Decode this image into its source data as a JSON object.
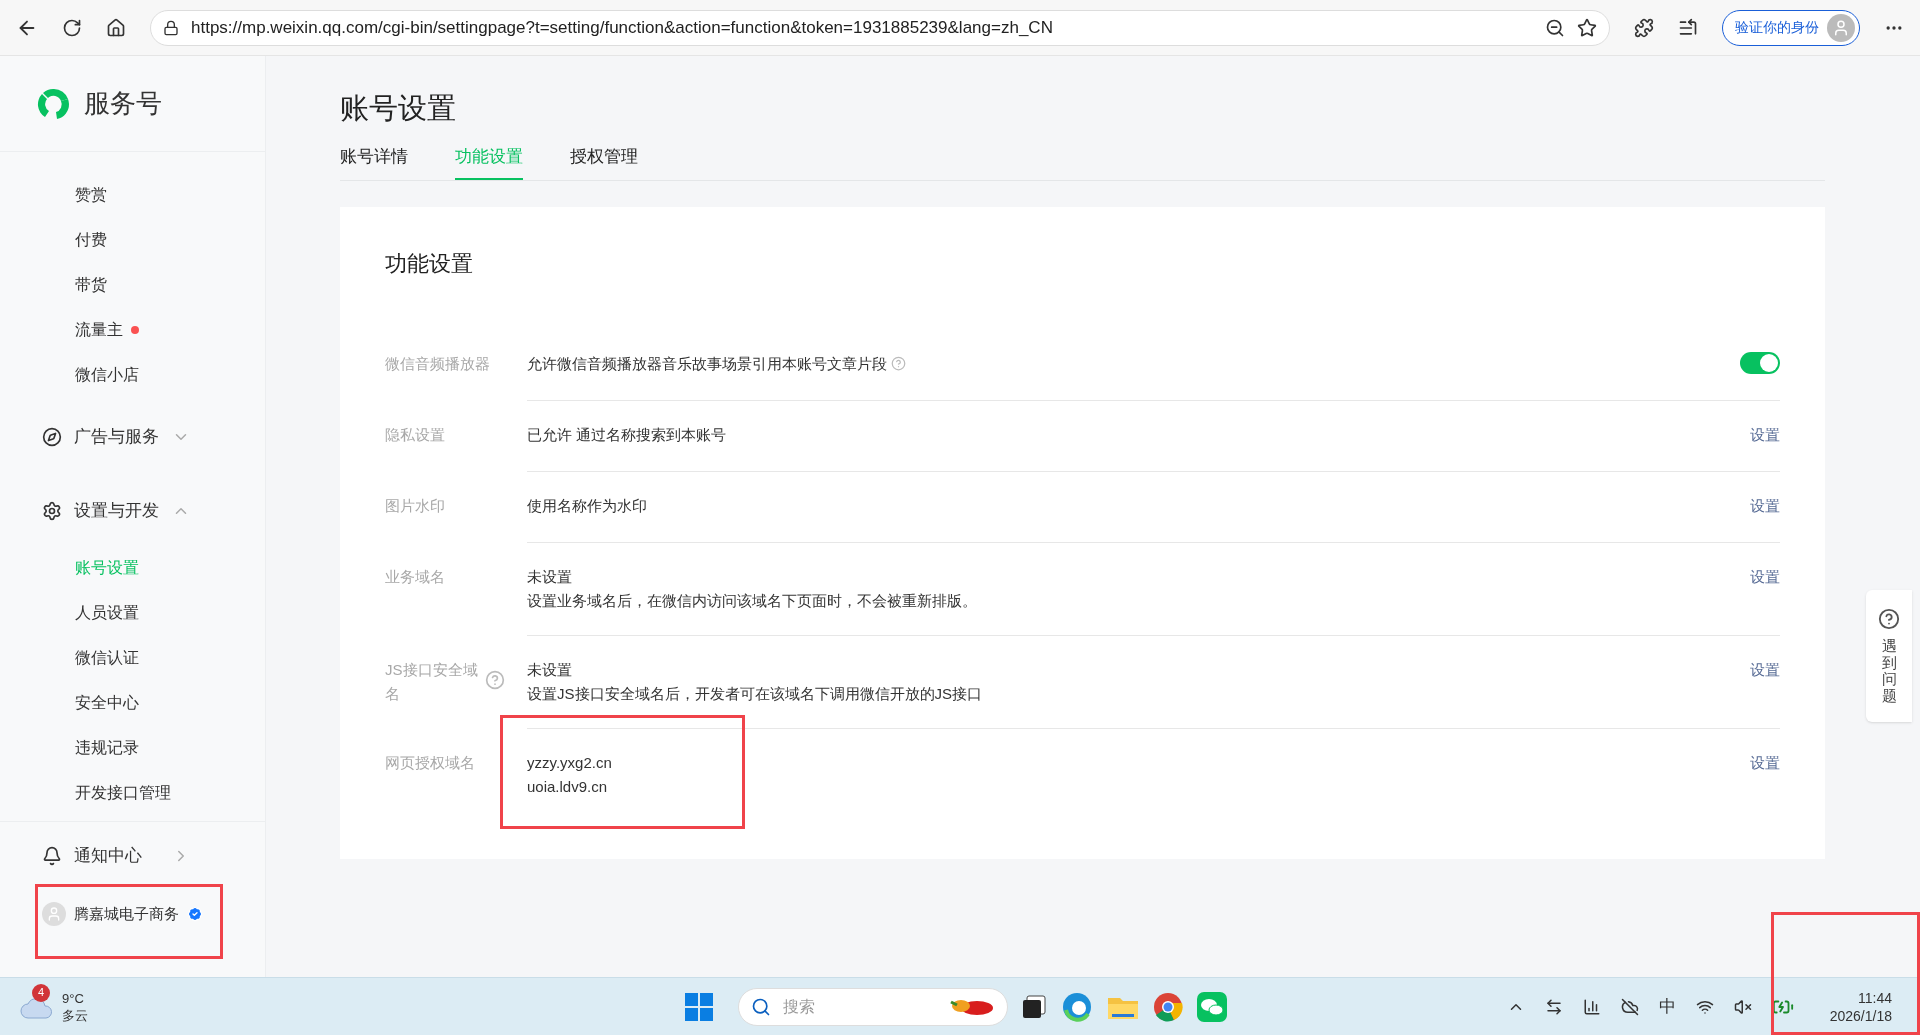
{
  "browser": {
    "url": "https://mp.weixin.qq.com/cgi-bin/settingpage?t=setting/function&action=function&token=1931885239&lang=zh_CN",
    "profile_button": "验证你的身份"
  },
  "sidebar": {
    "logo_text": "服务号",
    "nav": [
      {
        "kind": "item",
        "label": "赞赏",
        "selected": false,
        "dot": false
      },
      {
        "kind": "item",
        "label": "付费",
        "selected": false,
        "dot": false
      },
      {
        "kind": "item",
        "label": "带货",
        "selected": false,
        "dot": false
      },
      {
        "kind": "item",
        "label": "流量主",
        "selected": false,
        "dot": true
      },
      {
        "kind": "item",
        "label": "微信小店",
        "selected": false,
        "dot": false
      },
      {
        "kind": "group",
        "label": "广告与服务",
        "expanded": false
      },
      {
        "kind": "group",
        "label": "设置与开发",
        "expanded": true
      },
      {
        "kind": "item",
        "label": "账号设置",
        "selected": true,
        "dot": false
      },
      {
        "kind": "item",
        "label": "人员设置",
        "selected": false,
        "dot": false
      },
      {
        "kind": "item",
        "label": "微信认证",
        "selected": false,
        "dot": false
      },
      {
        "kind": "item",
        "label": "安全中心",
        "selected": false,
        "dot": false
      },
      {
        "kind": "item",
        "label": "违规记录",
        "selected": false,
        "dot": false
      },
      {
        "kind": "item",
        "label": "开发接口管理",
        "selected": false,
        "dot": false
      },
      {
        "kind": "link",
        "label": "通知中心"
      }
    ],
    "account": {
      "name": "腾嘉城电子商务",
      "verified": true
    }
  },
  "page": {
    "title": "账号设置",
    "tabs": [
      {
        "label": "账号详情",
        "selected": false
      },
      {
        "label": "功能设置",
        "selected": true
      },
      {
        "label": "授权管理",
        "selected": false
      }
    ]
  },
  "card": {
    "title": "功能设置",
    "rows": [
      {
        "label": "微信音频播放器",
        "label_help": false,
        "lines": [
          "允许微信音频播放器音乐故事场景引用本账号文章片段"
        ],
        "value_help": true,
        "control": {
          "kind": "toggle",
          "on": true
        }
      },
      {
        "label": "隐私设置",
        "label_help": false,
        "lines": [
          "已允许 通过名称搜索到本账号"
        ],
        "value_help": false,
        "control": {
          "kind": "link",
          "text": "设置"
        }
      },
      {
        "label": "图片水印",
        "label_help": false,
        "lines": [
          "使用名称作为水印"
        ],
        "value_help": false,
        "control": {
          "kind": "link",
          "text": "设置"
        }
      },
      {
        "label": "业务域名",
        "label_help": false,
        "lines": [
          "未设置",
          "设置业务域名后，在微信内访问该域名下页面时，不会被重新排版。"
        ],
        "value_help": false,
        "control": {
          "kind": "link",
          "text": "设置"
        }
      },
      {
        "label": "JS接口安全域名",
        "label_help": true,
        "lines": [
          "未设置",
          "设置JS接口安全域名后，开发者可在该域名下调用微信开放的JS接口"
        ],
        "value_help": false,
        "control": {
          "kind": "link",
          "text": "设置"
        }
      },
      {
        "label": "网页授权域名",
        "label_help": false,
        "lines": [
          "yzzy.yxg2.cn",
          "uoia.ldv9.cn"
        ],
        "value_help": false,
        "control": {
          "kind": "link",
          "text": "设置"
        }
      }
    ]
  },
  "help_float": {
    "label": "遇到问题"
  },
  "taskbar": {
    "weather": {
      "badge": "4",
      "temp": "9°C",
      "condition": "多云"
    },
    "search_placeholder": "搜索",
    "ime": "中",
    "time": "11:44",
    "date": "2026/1/18"
  }
}
